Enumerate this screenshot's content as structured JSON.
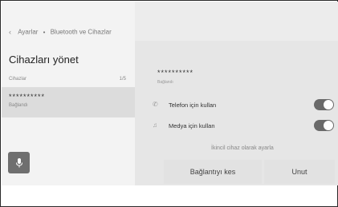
{
  "breadcrumb": {
    "parent": "Ayarlar",
    "separator": "•",
    "current": "Bluetooth ve Cihazlar"
  },
  "page": {
    "title": "Cihazları yönet"
  },
  "device_list": {
    "header": "Cihazlar",
    "count": "1/5",
    "items": [
      {
        "name": "**********",
        "status": "Bağlandı"
      }
    ]
  },
  "detail": {
    "name": "**********",
    "status": "Bağlandı",
    "options": [
      {
        "label": "Telefon için kullan",
        "icon": "phone-icon",
        "enabled": true
      },
      {
        "label": "Medya için kullan",
        "icon": "music-note-icon",
        "enabled": true
      }
    ],
    "secondary_label": "İkincil cihaz olarak ayarla",
    "disconnect_label": "Bağlantıyı kes",
    "forget_label": "Unut"
  },
  "icons": {
    "back": "chevron-left-icon",
    "mic": "microphone-icon"
  }
}
